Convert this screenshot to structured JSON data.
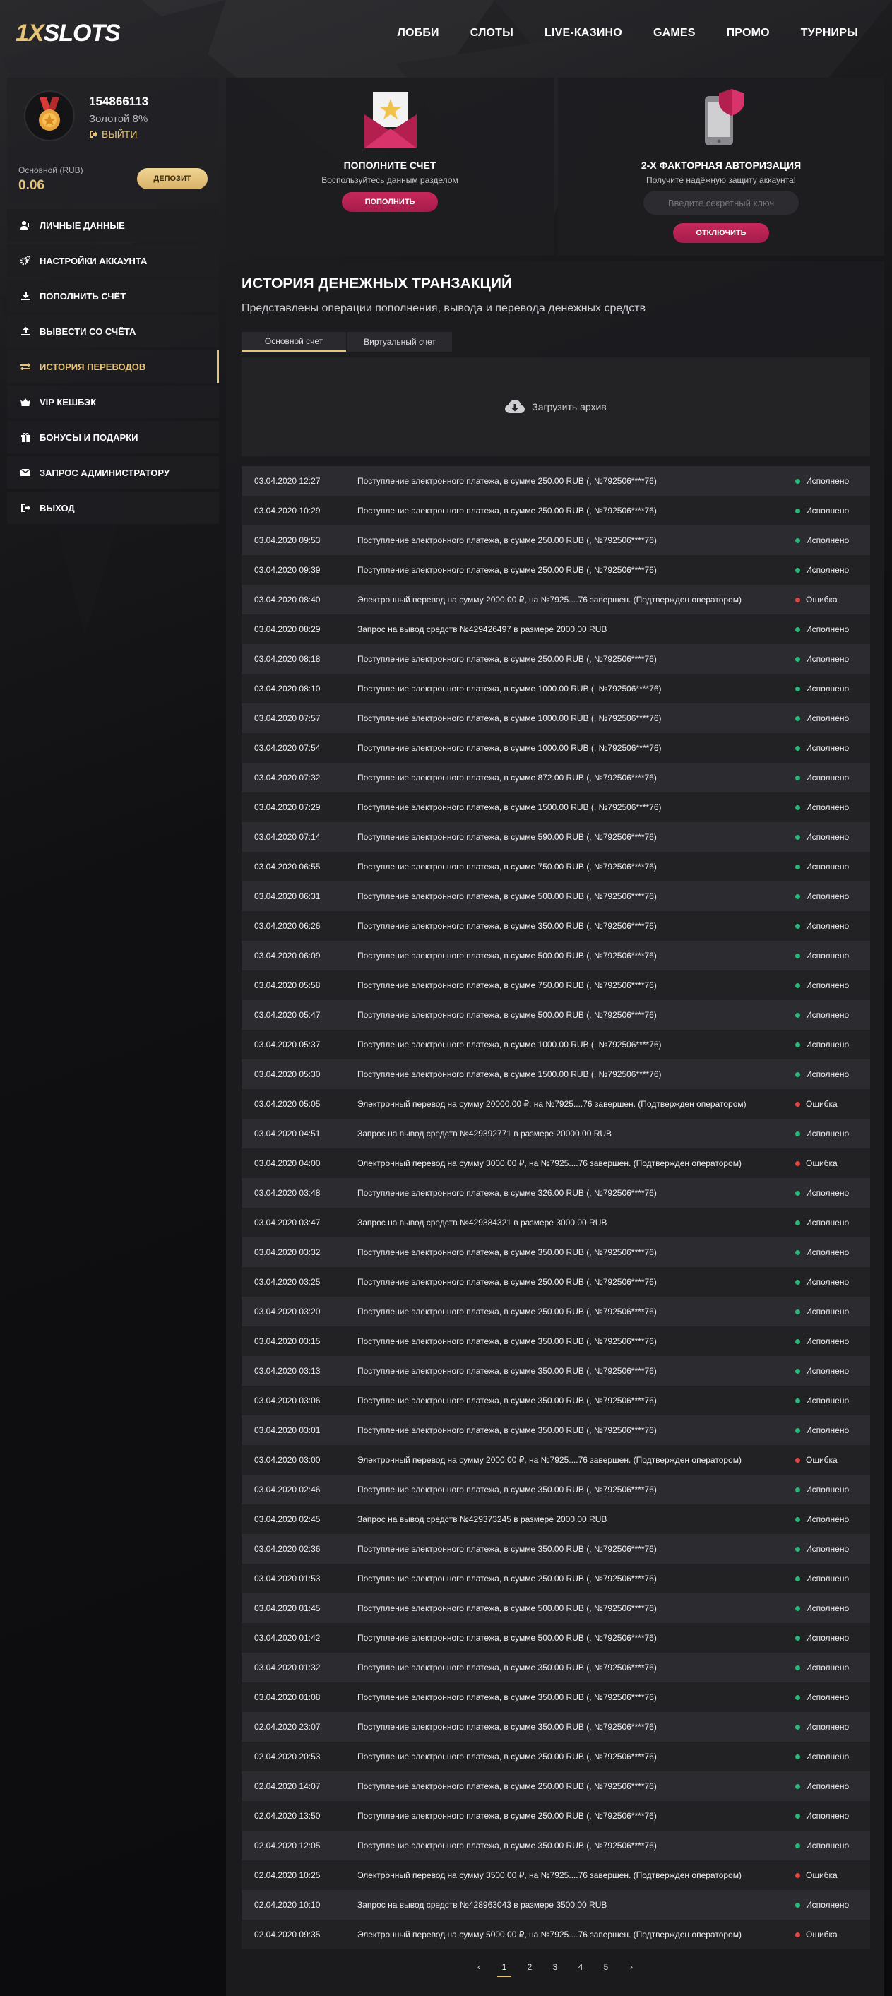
{
  "header": {
    "logo_prefix": "1X",
    "logo_rest": "SLOTS",
    "nav": [
      "ЛОББИ",
      "СЛОТЫ",
      "LIVE-КАЗИНО",
      "GAMES",
      "ПРОМО",
      "ТУРНИРЫ"
    ]
  },
  "profile": {
    "user_id": "154866113",
    "level": "Золотой 8%",
    "logout": "ВЫЙТИ",
    "balance_label": "Основной (RUB)",
    "balance_value": "0.06",
    "deposit_button": "ДЕПОЗИТ"
  },
  "menu": [
    {
      "label": "ЛИЧНЫЕ ДАННЫЕ",
      "icon": "user-plus-icon"
    },
    {
      "label": "НАСТРОЙКИ АККАУНТА",
      "icon": "gears-icon"
    },
    {
      "label": "ПОПОЛНИТЬ СЧЁТ",
      "icon": "download-icon"
    },
    {
      "label": "ВЫВЕСТИ СО СЧЁТА",
      "icon": "upload-icon"
    },
    {
      "label": "ИСТОРИЯ ПЕРЕВОДОВ",
      "icon": "transfer-icon"
    },
    {
      "label": "VIP КЕШБЭК",
      "icon": "crown-icon"
    },
    {
      "label": "БОНУСЫ И ПОДАРКИ",
      "icon": "gift-icon"
    },
    {
      "label": "ЗАПРОС АДМИНИСТРАТОРУ",
      "icon": "envelope-icon"
    },
    {
      "label": "ВЫХОД",
      "icon": "exit-icon"
    }
  ],
  "active_menu_index": 4,
  "deposit_card": {
    "title": "ПОПОЛНИТЕ СЧЕТ",
    "subtitle": "Воспользуйтесь данным разделом",
    "button": "ПОПОЛНИТЬ"
  },
  "twofa_card": {
    "title": "2-Х ФАКТОРНАЯ АВТОРИЗАЦИЯ",
    "subtitle": "Получите надёжную защиту аккаунта!",
    "input_placeholder": "Введите секретный ключ",
    "button": "ОТКЛЮЧИТЬ"
  },
  "main": {
    "title": "ИСТОРИЯ ДЕНЕЖНЫХ ТРАНЗАКЦИЙ",
    "subtitle": "Представлены операции пополнения, вывода и перевода денежных средств",
    "tabs": [
      "Основной счет",
      "Виртуальный счет"
    ],
    "upload_label": "Загрузить архив"
  },
  "status_labels": {
    "ok": "Исполнено",
    "err": "Ошибка"
  },
  "transactions": [
    {
      "date": "03.04.2020 12:27",
      "desc": "Поступление электронного платежа, в сумме 250.00 RUB (, №792506****76)",
      "status": "ok"
    },
    {
      "date": "03.04.2020 10:29",
      "desc": "Поступление электронного платежа, в сумме 250.00 RUB (, №792506****76)",
      "status": "ok"
    },
    {
      "date": "03.04.2020 09:53",
      "desc": "Поступление электронного платежа, в сумме 250.00 RUB (, №792506****76)",
      "status": "ok"
    },
    {
      "date": "03.04.2020 09:39",
      "desc": "Поступление электронного платежа, в сумме 250.00 RUB (, №792506****76)",
      "status": "ok"
    },
    {
      "date": "03.04.2020 08:40",
      "desc": "Электронный перевод на сумму 2000.00 ₽, на №7925....76 завершен. (Подтвержден оператором)",
      "status": "err"
    },
    {
      "date": "03.04.2020 08:29",
      "desc": "Запрос на вывод средств №429426497 в размере 2000.00 RUB",
      "status": "ok"
    },
    {
      "date": "03.04.2020 08:18",
      "desc": "Поступление электронного платежа, в сумме 250.00 RUB (, №792506****76)",
      "status": "ok"
    },
    {
      "date": "03.04.2020 08:10",
      "desc": "Поступление электронного платежа, в сумме 1000.00 RUB (, №792506****76)",
      "status": "ok"
    },
    {
      "date": "03.04.2020 07:57",
      "desc": "Поступление электронного платежа, в сумме 1000.00 RUB (, №792506****76)",
      "status": "ok"
    },
    {
      "date": "03.04.2020 07:54",
      "desc": "Поступление электронного платежа, в сумме 1000.00 RUB (, №792506****76)",
      "status": "ok"
    },
    {
      "date": "03.04.2020 07:32",
      "desc": "Поступление электронного платежа, в сумме 872.00 RUB (, №792506****76)",
      "status": "ok"
    },
    {
      "date": "03.04.2020 07:29",
      "desc": "Поступление электронного платежа, в сумме 1500.00 RUB (, №792506****76)",
      "status": "ok"
    },
    {
      "date": "03.04.2020 07:14",
      "desc": "Поступление электронного платежа, в сумме 590.00 RUB (, №792506****76)",
      "status": "ok"
    },
    {
      "date": "03.04.2020 06:55",
      "desc": "Поступление электронного платежа, в сумме 750.00 RUB (, №792506****76)",
      "status": "ok"
    },
    {
      "date": "03.04.2020 06:31",
      "desc": "Поступление электронного платежа, в сумме 500.00 RUB (, №792506****76)",
      "status": "ok"
    },
    {
      "date": "03.04.2020 06:26",
      "desc": "Поступление электронного платежа, в сумме 350.00 RUB (, №792506****76)",
      "status": "ok"
    },
    {
      "date": "03.04.2020 06:09",
      "desc": "Поступление электронного платежа, в сумме 500.00 RUB (, №792506****76)",
      "status": "ok"
    },
    {
      "date": "03.04.2020 05:58",
      "desc": "Поступление электронного платежа, в сумме 750.00 RUB (, №792506****76)",
      "status": "ok"
    },
    {
      "date": "03.04.2020 05:47",
      "desc": "Поступление электронного платежа, в сумме 500.00 RUB (, №792506****76)",
      "status": "ok"
    },
    {
      "date": "03.04.2020 05:37",
      "desc": "Поступление электронного платежа, в сумме 1000.00 RUB (, №792506****76)",
      "status": "ok"
    },
    {
      "date": "03.04.2020 05:30",
      "desc": "Поступление электронного платежа, в сумме 1500.00 RUB (, №792506****76)",
      "status": "ok"
    },
    {
      "date": "03.04.2020 05:05",
      "desc": "Электронный перевод на сумму 20000.00 ₽, на №7925....76 завершен. (Подтвержден оператором)",
      "status": "err"
    },
    {
      "date": "03.04.2020 04:51",
      "desc": "Запрос на вывод средств №429392771 в размере 20000.00 RUB",
      "status": "ok"
    },
    {
      "date": "03.04.2020 04:00",
      "desc": "Электронный перевод на сумму 3000.00 ₽, на №7925....76 завершен. (Подтвержден оператором)",
      "status": "err"
    },
    {
      "date": "03.04.2020 03:48",
      "desc": "Поступление электронного платежа, в сумме 326.00 RUB (, №792506****76)",
      "status": "ok"
    },
    {
      "date": "03.04.2020 03:47",
      "desc": "Запрос на вывод средств №429384321 в размере 3000.00 RUB",
      "status": "ok"
    },
    {
      "date": "03.04.2020 03:32",
      "desc": "Поступление электронного платежа, в сумме 350.00 RUB (, №792506****76)",
      "status": "ok"
    },
    {
      "date": "03.04.2020 03:25",
      "desc": "Поступление электронного платежа, в сумме 250.00 RUB (, №792506****76)",
      "status": "ok"
    },
    {
      "date": "03.04.2020 03:20",
      "desc": "Поступление электронного платежа, в сумме 250.00 RUB (, №792506****76)",
      "status": "ok"
    },
    {
      "date": "03.04.2020 03:15",
      "desc": "Поступление электронного платежа, в сумме 350.00 RUB (, №792506****76)",
      "status": "ok"
    },
    {
      "date": "03.04.2020 03:13",
      "desc": "Поступление электронного платежа, в сумме 350.00 RUB (, №792506****76)",
      "status": "ok"
    },
    {
      "date": "03.04.2020 03:06",
      "desc": "Поступление электронного платежа, в сумме 350.00 RUB (, №792506****76)",
      "status": "ok"
    },
    {
      "date": "03.04.2020 03:01",
      "desc": "Поступление электронного платежа, в сумме 350.00 RUB (, №792506****76)",
      "status": "ok"
    },
    {
      "date": "03.04.2020 03:00",
      "desc": "Электронный перевод на сумму 2000.00 ₽, на №7925....76 завершен. (Подтвержден оператором)",
      "status": "err"
    },
    {
      "date": "03.04.2020 02:46",
      "desc": "Поступление электронного платежа, в сумме 350.00 RUB (, №792506****76)",
      "status": "ok"
    },
    {
      "date": "03.04.2020 02:45",
      "desc": "Запрос на вывод средств №429373245 в размере 2000.00 RUB",
      "status": "ok"
    },
    {
      "date": "03.04.2020 02:36",
      "desc": "Поступление электронного платежа, в сумме 350.00 RUB (, №792506****76)",
      "status": "ok"
    },
    {
      "date": "03.04.2020 01:53",
      "desc": "Поступление электронного платежа, в сумме 250.00 RUB (, №792506****76)",
      "status": "ok"
    },
    {
      "date": "03.04.2020 01:45",
      "desc": "Поступление электронного платежа, в сумме 500.00 RUB (, №792506****76)",
      "status": "ok"
    },
    {
      "date": "03.04.2020 01:42",
      "desc": "Поступление электронного платежа, в сумме 500.00 RUB (, №792506****76)",
      "status": "ok"
    },
    {
      "date": "03.04.2020 01:32",
      "desc": "Поступление электронного платежа, в сумме 350.00 RUB (, №792506****76)",
      "status": "ok"
    },
    {
      "date": "03.04.2020 01:08",
      "desc": "Поступление электронного платежа, в сумме 350.00 RUB (, №792506****76)",
      "status": "ok"
    },
    {
      "date": "02.04.2020 23:07",
      "desc": "Поступление электронного платежа, в сумме 350.00 RUB (, №792506****76)",
      "status": "ok"
    },
    {
      "date": "02.04.2020 20:53",
      "desc": "Поступление электронного платежа, в сумме 250.00 RUB (, №792506****76)",
      "status": "ok"
    },
    {
      "date": "02.04.2020 14:07",
      "desc": "Поступление электронного платежа, в сумме 250.00 RUB (, №792506****76)",
      "status": "ok"
    },
    {
      "date": "02.04.2020 13:50",
      "desc": "Поступление электронного платежа, в сумме 250.00 RUB (, №792506****76)",
      "status": "ok"
    },
    {
      "date": "02.04.2020 12:05",
      "desc": "Поступление электронного платежа, в сумме 350.00 RUB (, №792506****76)",
      "status": "ok"
    },
    {
      "date": "02.04.2020 10:25",
      "desc": "Электронный перевод на сумму 3500.00 ₽, на №7925....76 завершен. (Подтвержден оператором)",
      "status": "err"
    },
    {
      "date": "02.04.2020 10:10",
      "desc": "Запрос на вывод средств №428963043 в размере 3500.00 RUB",
      "status": "ok"
    },
    {
      "date": "02.04.2020 09:35",
      "desc": "Электронный перевод на сумму 5000.00 ₽, на №7925....76 завершен. (Подтвержден оператором)",
      "status": "err"
    }
  ],
  "pagination": {
    "prev": "‹",
    "next": "›",
    "pages": [
      "1",
      "2",
      "3",
      "4",
      "5"
    ],
    "current": "1"
  },
  "colors": {
    "accent": "#e8c477",
    "pink": "#c8285c",
    "ok": "#2fb57a",
    "err": "#e04848"
  }
}
